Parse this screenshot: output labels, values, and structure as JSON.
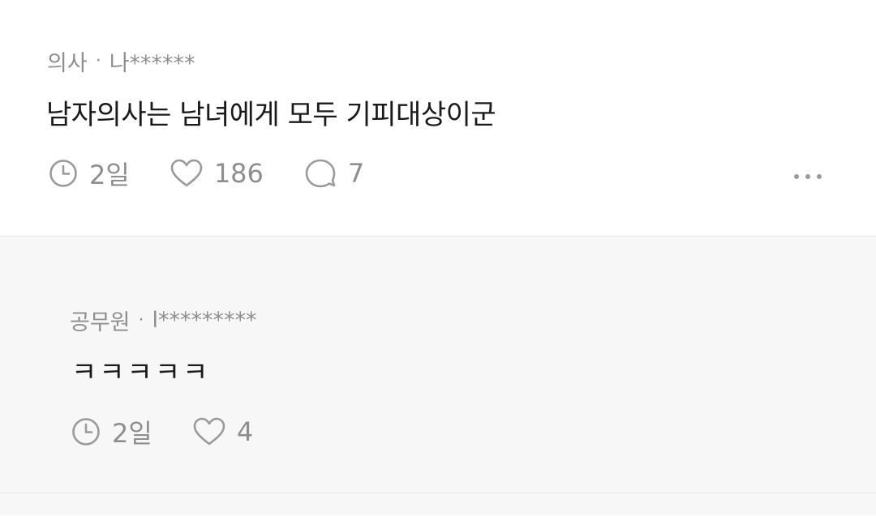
{
  "comment": {
    "job": "의사",
    "separator": "·",
    "user": "나******",
    "text": "남자의사는 남녀에게 모두 기피대상이군",
    "time": "2일",
    "likes": "186",
    "replies": "7",
    "icons": {
      "time": "clock-icon",
      "like": "heart-icon",
      "reply": "comment-icon",
      "more": "more-icon"
    }
  },
  "reply": {
    "job": "공무원",
    "separator": "·",
    "user": "l*********",
    "text": "ㅋㅋㅋㅋㅋ",
    "time": "2일",
    "likes": "4"
  },
  "colors": {
    "meta": "#8e8e8e",
    "text": "#1a1a1a",
    "reply_bg": "#f7f7f7",
    "divider": "#e6e6e6"
  }
}
